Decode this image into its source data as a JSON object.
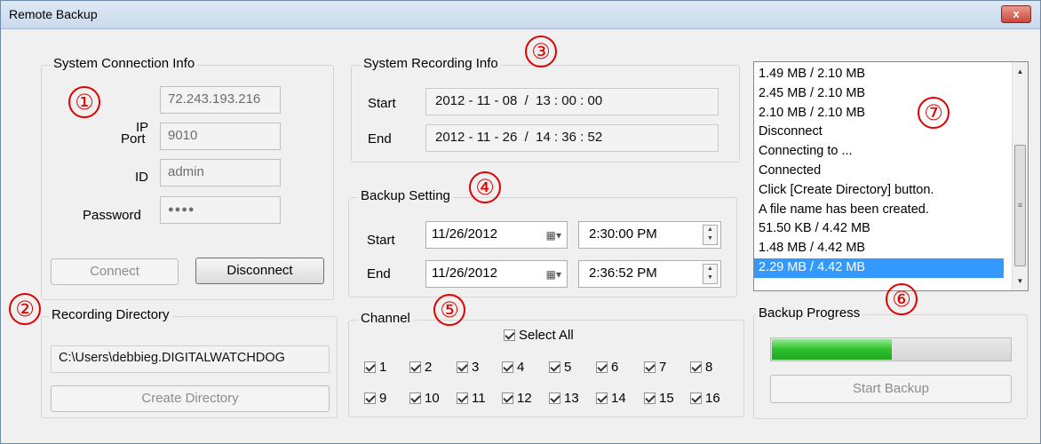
{
  "window": {
    "title": "Remote Backup",
    "close": "x"
  },
  "markers": [
    "①",
    "②",
    "③",
    "④",
    "⑤",
    "⑥",
    "⑦"
  ],
  "connection": {
    "legend": "System Connection Info",
    "ip_label": "IP",
    "ip_value": "72.243.193.216",
    "port_label": "Port",
    "port_value": "9010",
    "id_label": "ID",
    "id_value": "admin",
    "password_label": "Password",
    "password_value": "●●●●",
    "connect_label": "Connect",
    "disconnect_label": "Disconnect"
  },
  "recording_info": {
    "legend": "System Recording Info",
    "start_label": "Start",
    "start_value": "2012 - 11 - 08  /  13 : 00 : 00",
    "end_label": "End",
    "end_value": "2012 - 11 - 26  /  14 : 36 : 52"
  },
  "backup_setting": {
    "legend": "Backup Setting",
    "start_label": "Start",
    "start_date": "11/26/2012",
    "start_time": "2:30:00 PM",
    "end_label": "End",
    "end_date": "11/26/2012",
    "end_time": "2:36:52 PM"
  },
  "directory": {
    "legend": "Recording Directory",
    "path": "C:\\Users\\debbieg.DIGITALWATCHDOG",
    "create_label": "Create Directory"
  },
  "channel": {
    "legend": "Channel",
    "select_all": "Select All",
    "channels": [
      "1",
      "2",
      "3",
      "4",
      "5",
      "6",
      "7",
      "8",
      "9",
      "10",
      "11",
      "12",
      "13",
      "14",
      "15",
      "16"
    ]
  },
  "log": {
    "items": [
      "1.49 MB / 2.10 MB",
      "2.45 MB / 2.10 MB",
      "2.10 MB / 2.10 MB",
      "Disconnect",
      "Connecting to ...",
      "Connected",
      "Click [Create Directory] button.",
      "A file name has been created.",
      "51.50 KB / 4.42 MB",
      "1.48 MB / 4.42 MB",
      "2.29 MB / 4.42 MB"
    ],
    "selected_index": 10
  },
  "progress": {
    "legend": "Backup Progress",
    "value": 0.5,
    "start_label": "Start Backup",
    "colors": {
      "fill": "#2cc22c",
      "track": "#dcdcdc"
    }
  },
  "colors": {
    "selection": "#3399ff",
    "marker": "#e00000"
  }
}
